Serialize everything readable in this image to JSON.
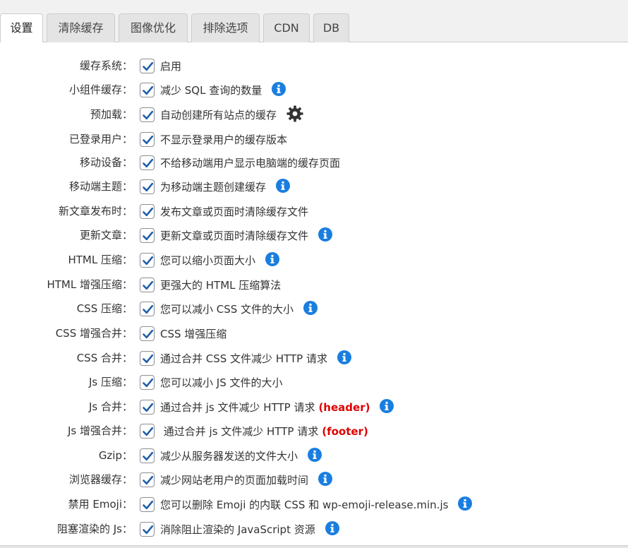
{
  "tabs": [
    {
      "label": "设置",
      "active": true
    },
    {
      "label": "清除缓存",
      "active": false
    },
    {
      "label": "图像优化",
      "active": false
    },
    {
      "label": "排除选项",
      "active": false
    },
    {
      "label": "CDN",
      "active": false
    },
    {
      "label": "DB",
      "active": false
    }
  ],
  "settings": [
    {
      "label": "缓存系统：",
      "desc": "启用",
      "checked": true,
      "icon": null
    },
    {
      "label": "小组件缓存：",
      "desc": "减少 SQL 查询的数量",
      "checked": true,
      "icon": "info-icon"
    },
    {
      "label": "预加载：",
      "desc": "自动创建所有站点的缓存",
      "checked": true,
      "icon": "gear-icon"
    },
    {
      "label": "已登录用户：",
      "desc": "不显示登录用户的缓存版本",
      "checked": true,
      "icon": null
    },
    {
      "label": "移动设备：",
      "desc": "不给移动端用户显示电脑端的缓存页面",
      "checked": true,
      "icon": null
    },
    {
      "label": "移动端主题：",
      "desc": "为移动端主题创建缓存",
      "checked": true,
      "icon": "info-icon"
    },
    {
      "label": "新文章发布时：",
      "desc": "发布文章或页面时清除缓存文件",
      "checked": true,
      "icon": null
    },
    {
      "label": "更新文章：",
      "desc": "更新文章或页面时清除缓存文件",
      "checked": true,
      "icon": "info-icon"
    },
    {
      "label": "HTML 压缩：",
      "desc": "您可以缩小页面大小",
      "checked": true,
      "icon": "info-icon"
    },
    {
      "label": "HTML 增强压缩：",
      "desc": "更强大的 HTML 压缩算法",
      "checked": true,
      "icon": null
    },
    {
      "label": "CSS 压缩：",
      "desc": "您可以减小 CSS 文件的大小",
      "checked": true,
      "icon": "info-icon"
    },
    {
      "label": "CSS 增强合并：",
      "desc": "CSS 增强压缩",
      "checked": true,
      "icon": null
    },
    {
      "label": "CSS 合并：",
      "desc": "通过合并 CSS 文件减少 HTTP 请求",
      "checked": true,
      "icon": "info-icon"
    },
    {
      "label": "Js 压缩：",
      "desc": "您可以减小 JS 文件的大小",
      "checked": true,
      "icon": null
    },
    {
      "label": "Js 合并：",
      "desc": "通过合并 js 文件减少 HTTP 请求",
      "accent": "(header)",
      "checked": true,
      "icon": "info-icon"
    },
    {
      "label": "Js 增强合并：",
      "desc": " 通过合并 js 文件减少 HTTP 请求",
      "accent": "(footer)",
      "checked": true,
      "icon": null
    },
    {
      "label": "Gzip：",
      "desc": "减少从服务器发送的文件大小",
      "checked": true,
      "icon": "info-icon"
    },
    {
      "label": "浏览器缓存：",
      "desc": "减少网站老用户的页面加载时间",
      "checked": true,
      "icon": "info-icon"
    },
    {
      "label": "禁用 Emoji：",
      "desc": "您可以删除 Emoji 的内联 CSS 和 wp-emoji-release.min.js",
      "checked": true,
      "icon": "info-icon"
    },
    {
      "label": "阻塞渲染的 Js：",
      "desc": "消除阻止渲染的 JavaScript 资源",
      "checked": true,
      "icon": "info-icon"
    }
  ],
  "colors": {
    "accent": "#e00000",
    "info": "#1a7ee0",
    "check": "#1e5fa8"
  }
}
